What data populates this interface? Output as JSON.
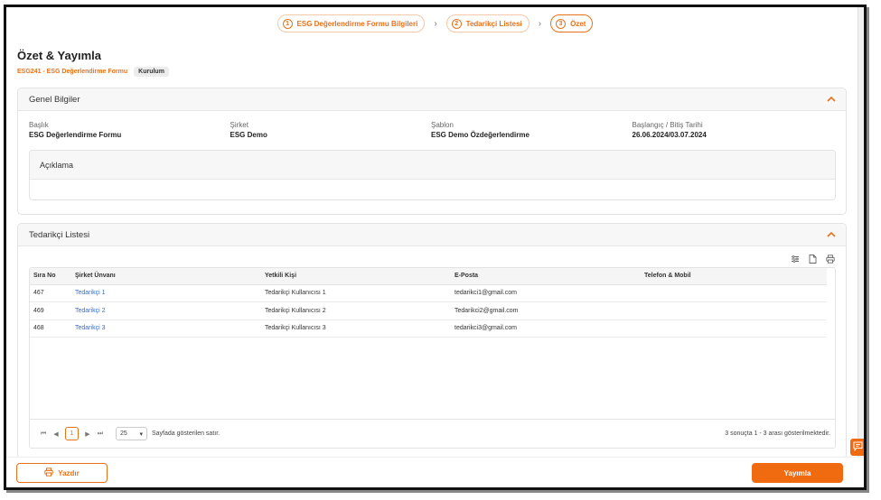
{
  "stepper": {
    "steps": [
      {
        "num": "1",
        "label": "ESG Değerlendirme Formu Bilgileri"
      },
      {
        "num": "2",
        "label": "Tedarikçi Listesi"
      },
      {
        "num": "3",
        "label": "Özet"
      }
    ],
    "separator": "›"
  },
  "page": {
    "title": "Özet & Yayımla",
    "form_code": "ESG241 - ESG Değerlendirme Formu",
    "badge": "Kurulum"
  },
  "general_info": {
    "title": "Genel Bilgiler",
    "fields": [
      {
        "label": "Başlık",
        "value": "ESG Değerlendirme Formu"
      },
      {
        "label": "Şirket",
        "value": "ESG Demo"
      },
      {
        "label": "Şablon",
        "value": "ESG Demo Özdeğerlendirme"
      },
      {
        "label": "Başlangıç / Bitiş Tarihi",
        "value": "26.06.2024/03.07.2024"
      }
    ],
    "description_title": "Açıklama"
  },
  "supplier_list": {
    "title": "Tedarikçi Listesi",
    "columns": [
      "Sıra No",
      "Şirket Ünvanı",
      "Yetkili Kişi",
      "E-Posta",
      "Telefon & Mobil"
    ],
    "rows": [
      {
        "no": "467",
        "company": "Tedarikçi 1",
        "contact": "Tedarikçi Kullanıcısı 1",
        "email": "tedarikci1@gmail.com",
        "phone": ""
      },
      {
        "no": "469",
        "company": "Tedarikçi 2",
        "contact": "Tedarikçi Kullanıcısı 2",
        "email": "Tedarikci2@gmail.com",
        "phone": ""
      },
      {
        "no": "468",
        "company": "Tedarikçi 3",
        "contact": "Tedarikçi Kullanıcısı 3",
        "email": "tedarikci3@gmail.com",
        "phone": ""
      }
    ],
    "pager": {
      "current_page": "1",
      "page_size": "25",
      "page_size_label": "Sayfada gösterilen satır.",
      "summary": "3 sonuçta 1 - 3 arası gösterilmektedir."
    }
  },
  "footer": {
    "print_label": "Yazdır",
    "publish_label": "Yayımla"
  },
  "icons": {
    "collapse": "chevron-up-icon",
    "columns": "sliders-icon",
    "export": "file-icon",
    "print": "printer-icon",
    "feedback": "feedback-icon"
  },
  "colors": {
    "accent": "#f06a10",
    "link": "#2f6fd6"
  }
}
